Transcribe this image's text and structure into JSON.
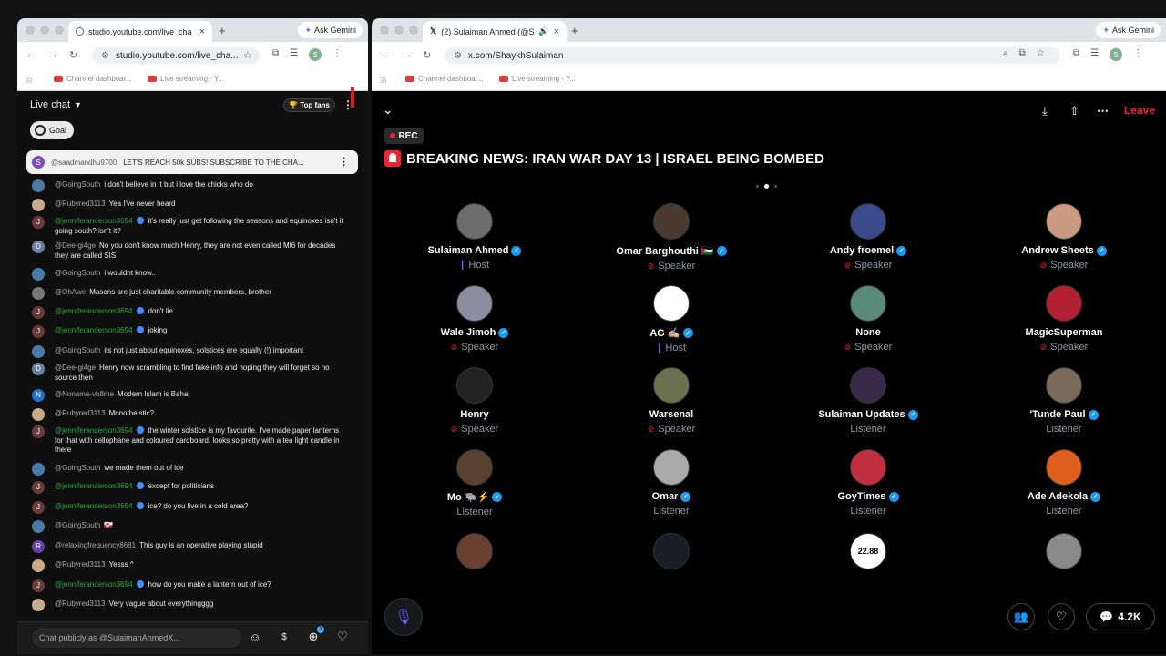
{
  "left": {
    "tab_title": "studio.youtube.com/live_cha",
    "ask_gemini": "Ask Gemini",
    "url": "studio.youtube.com/live_cha...",
    "bookmarks": [
      "Channel dashboar...",
      "Live streaming - Y..."
    ],
    "chat_header": "Live chat",
    "top_fans": "Top fans",
    "goal": "Goal",
    "pinned": {
      "avatar": "S",
      "author": "@saadmandhu9700",
      "text": "LET'S REACH 50k SUBS! SUBSCRIBE TO THE CHA..."
    },
    "messages": [
      {
        "author": "@GoingSouth",
        "text": "i don't believe in it but i love the chicks who do",
        "color": "#4a7aa8"
      },
      {
        "author": "@Rubyred3113",
        "text": "Yea I've never heard",
        "color": "#c9a98a"
      },
      {
        "author": "@jenniferanderson3694",
        "member": true,
        "text": "it's really just get following the seasons and equinoxes isn't it going south? isn't it?",
        "color": "#6b3a3a",
        "letter": "J"
      },
      {
        "author": "@Dee-gi4ge",
        "text": "No you don't know much Henry, they are not even called MI6 for decades they are called SIS",
        "color": "#6a7fa0",
        "letter": "D"
      },
      {
        "author": "@GoingSouth",
        "text": "i wouldnt know..",
        "color": "#4a7aa8"
      },
      {
        "author": "@OhAwe",
        "text": "Masons are just charitable community members, brother",
        "color": "#777777"
      },
      {
        "author": "@jenniferanderson3694",
        "member": true,
        "text": "don't lie",
        "color": "#6b3a3a",
        "letter": "J"
      },
      {
        "author": "@jenniferanderson3694",
        "member": true,
        "text": "joking",
        "color": "#6b3a3a",
        "letter": "J"
      },
      {
        "author": "@GoingSouth",
        "text": "its not just about equinoxes, solstices are equally (!) important",
        "color": "#4a7aa8"
      },
      {
        "author": "@Dee-gi4ge",
        "text": "Henry now scrambling to find fake info and hoping they will forget so no source then",
        "color": "#6a7fa0",
        "letter": "D"
      },
      {
        "author": "@Noname-vb8me",
        "text": "Modern Islam is Bahai",
        "color": "#1e73c8",
        "letter": "N"
      },
      {
        "author": "@Rubyred3113",
        "text": "Monotheistic?",
        "color": "#c9a98a"
      },
      {
        "author": "@jenniferanderson3694",
        "member": true,
        "text": "the winter solstice is my favourite. I've made paper lanterns for that with cellophane and coloured cardboard. looks so pretty with a tea light candle in there",
        "color": "#6b3a3a",
        "letter": "J"
      },
      {
        "author": "@GoingSouth",
        "text": "we made them out of ice",
        "color": "#4a7aa8"
      },
      {
        "author": "@jenniferanderson3694",
        "member": true,
        "text": "except for politicians",
        "color": "#6b3a3a",
        "letter": "J"
      },
      {
        "author": "@jenniferanderson3694",
        "member": true,
        "text": "ice? do you live in a cold area?",
        "color": "#6b3a3a",
        "letter": "J"
      },
      {
        "author": "@GoingSouth",
        "text": "🇬🇱",
        "color": "#4a7aa8"
      },
      {
        "author": "@relaxingfrequency8681",
        "text": "This guy is an operative playing stupid",
        "color": "#6a3fb0",
        "letter": "R"
      },
      {
        "author": "@Rubyred3113",
        "text": "Yesss ^",
        "color": "#c9a98a"
      },
      {
        "author": "@jenniferanderson3694",
        "member": true,
        "text": "how do you make a lantern out of ice?",
        "color": "#6b3a3a",
        "letter": "J"
      },
      {
        "author": "@Rubyred3113",
        "text": "Very vague about everythingggg",
        "color": "#c9a98a"
      }
    ],
    "chat_placeholder": "Chat publicly as @SulaimanAhmedX...",
    "avatar_letter": "S",
    "gift_count": "1"
  },
  "right": {
    "tab_title": "(2) Sulaiman Ahmed (@Sh",
    "ask_gemini": "Ask Gemini",
    "url": "x.com/ShaykhSulaiman",
    "bookmarks": [
      "Channel dashboar...",
      "Live streaming - Y..."
    ],
    "leave": "Leave",
    "rec": "REC",
    "title": "BREAKING NEWS: IRAN WAR DAY 13 | ISRAEL BEING BOMBED",
    "participants": [
      {
        "name": "Sulaiman Ahmed",
        "verified": true,
        "role": "Host",
        "color": "#6d6d6d"
      },
      {
        "name": "Omar Barghouthi 🇵🇸",
        "verified": true,
        "role": "Speaker",
        "color": "#4a3a30"
      },
      {
        "name": "Andy froemel",
        "verified": true,
        "role": "Speaker",
        "color": "#3a4a8a"
      },
      {
        "name": "Andrew Sheets",
        "verified": true,
        "role": "Speaker",
        "color": "#c99a80"
      },
      {
        "name": "Wale Jimoh",
        "verified": true,
        "role": "Speaker",
        "color": "#8a8fa0"
      },
      {
        "name": "AG ✍🏼",
        "verified": true,
        "role": "Host",
        "color": "#ffffff"
      },
      {
        "name": "None",
        "verified": false,
        "role": "Speaker",
        "color": "#5a8a7a"
      },
      {
        "name": "MagicSuperman",
        "verified": false,
        "role": "Speaker",
        "color": "#b02030"
      },
      {
        "name": "Henry",
        "verified": false,
        "role": "Speaker",
        "color": "#222222"
      },
      {
        "name": "Warsenal",
        "verified": false,
        "role": "Speaker",
        "color": "#6a7050"
      },
      {
        "name": "Sulaiman Updates",
        "verified": true,
        "role": "Listener",
        "color": "#3a2a4a"
      },
      {
        "name": "'Tunde Paul",
        "verified": true,
        "role": "Listener",
        "color": "#7a6a5a"
      },
      {
        "name": "Mo 🐃⚡",
        "verified": true,
        "role": "Listener",
        "color": "#5a4030"
      },
      {
        "name": "Omar",
        "verified": true,
        "role": "Listener",
        "color": "#aaaaaa"
      },
      {
        "name": "GoyTimes",
        "verified": true,
        "role": "Listener",
        "color": "#c03040"
      },
      {
        "name": "Ade Adekola",
        "verified": true,
        "role": "Listener",
        "color": "#e06020"
      }
    ],
    "partial_avatars": [
      "",
      "",
      "22.88",
      ""
    ],
    "listener_count": "4.2K"
  }
}
